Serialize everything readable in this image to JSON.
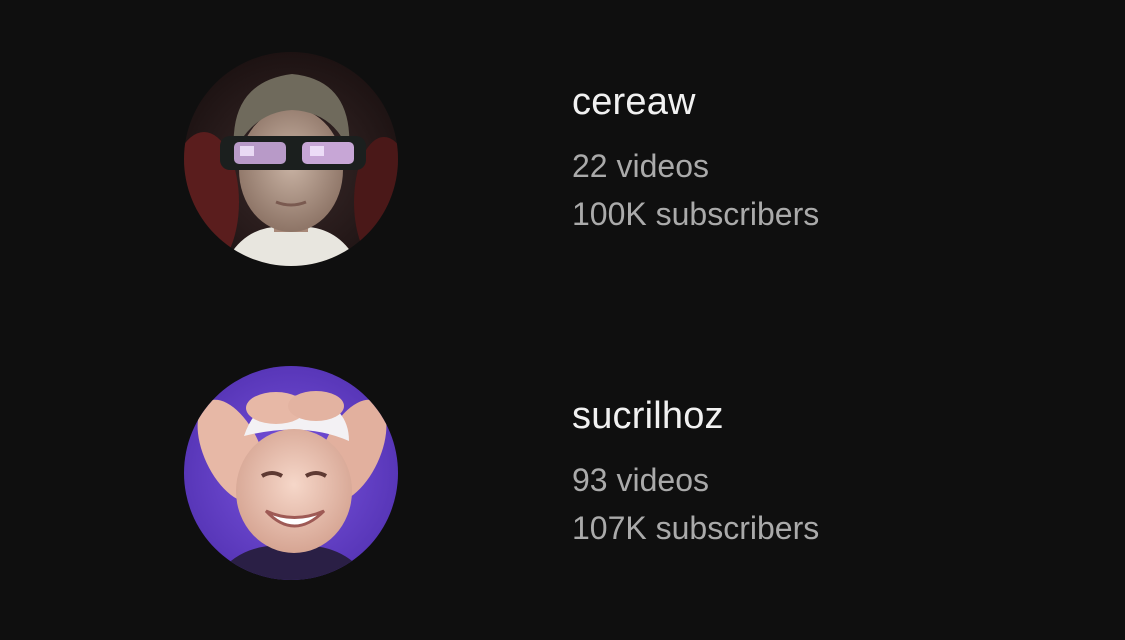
{
  "channels": [
    {
      "name": "cereaw",
      "videos": "22 videos",
      "subscribers": "100K subscribers",
      "avatar_icon": "boy-with-3d-glasses-avatar"
    },
    {
      "name": "sucrilhoz",
      "videos": "93 videos",
      "subscribers": "107K subscribers",
      "avatar_icon": "smiling-boy-purple-avatar"
    }
  ],
  "colors": {
    "background": "#0f0f0f",
    "name_text": "#f1f1f1",
    "meta_text": "#aaaaaa",
    "avatar2_bg": "#6a3fd0"
  }
}
